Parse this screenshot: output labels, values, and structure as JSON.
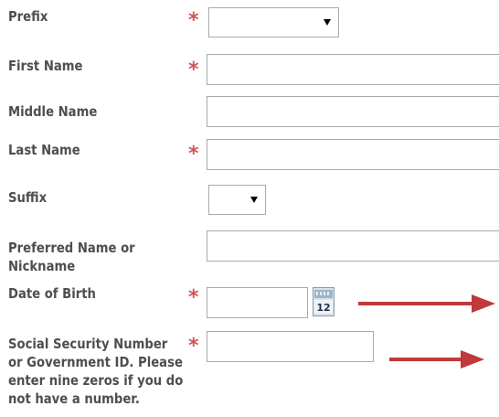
{
  "fields": [
    {
      "label": "Prefix",
      "required": true
    },
    {
      "label": "First Name",
      "required": true
    },
    {
      "label": "Middle Name",
      "required": false
    },
    {
      "label": "Last Name",
      "required": true
    },
    {
      "label": "Suffix",
      "required": false
    },
    {
      "label_lines": [
        "Preferred Name or",
        "Nickname"
      ],
      "required": false
    },
    {
      "label": "Date of Birth",
      "required": true
    },
    {
      "label_lines": [
        "Social Security Number",
        "or Government ID. Please",
        "enter nine zeros if you do",
        "not have a number."
      ],
      "required": true
    }
  ],
  "required_marker": "*",
  "calendar_icon_text": "12",
  "colors": {
    "label": "#4e4e4e",
    "required": "#d05656",
    "arrow": "#c0393b",
    "border": "#a9a9a9"
  }
}
